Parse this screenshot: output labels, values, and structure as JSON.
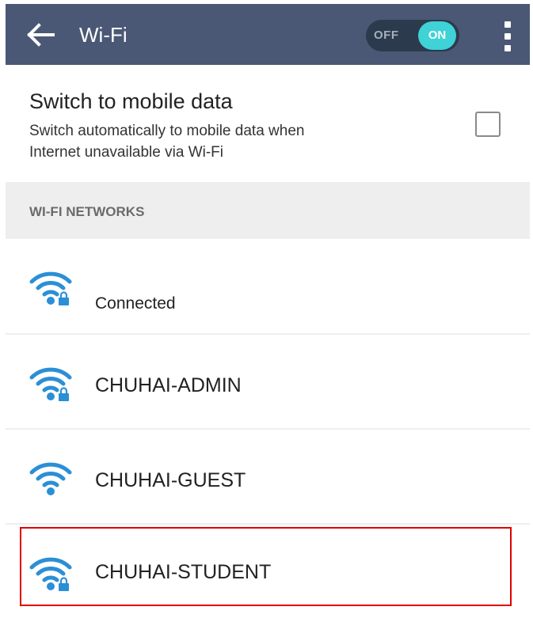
{
  "appbar": {
    "title": "Wi-Fi",
    "toggle_off_label": "OFF",
    "toggle_on_label": "ON",
    "toggle_state": "on"
  },
  "mobile_data": {
    "title": "Switch to mobile data",
    "description_line1": "Switch automatically to mobile data when",
    "description_line2": "Internet unavailable via Wi-Fi",
    "checked": false
  },
  "networks_header": "WI-FI NETWORKS",
  "networks": [
    {
      "name": "",
      "status": "Connected",
      "secured": true
    },
    {
      "name": "CHUHAI-ADMIN",
      "status": "",
      "secured": true
    },
    {
      "name": "CHUHAI-GUEST",
      "status": "",
      "secured": false
    },
    {
      "name": "CHUHAI-STUDENT",
      "status": "",
      "secured": true,
      "highlighted": true
    }
  ],
  "colors": {
    "appbar": "#4a5875",
    "toggle_on": "#3fd2d6",
    "wifi_icon": "#2b8fd6",
    "highlight": "#e00000"
  }
}
